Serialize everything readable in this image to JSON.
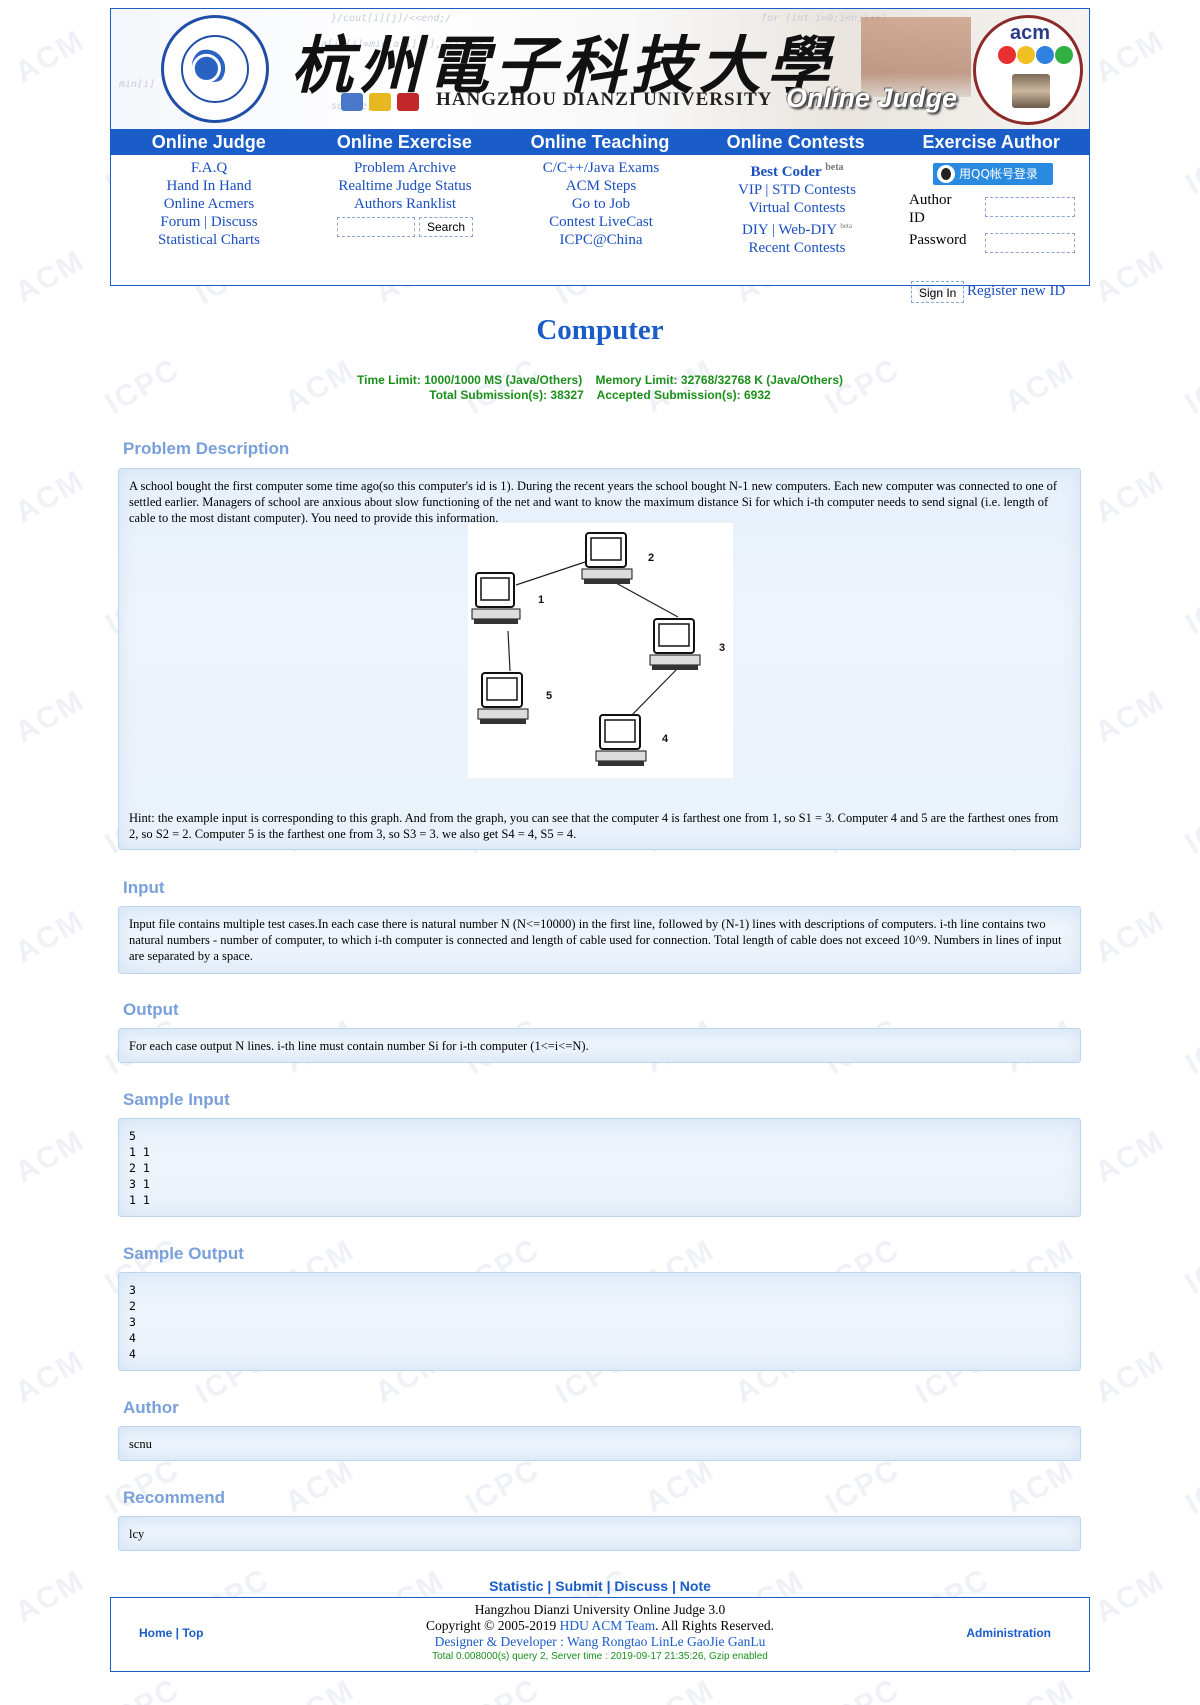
{
  "header": {
    "university_cn": "杭州電子科技大學",
    "university_en": "HANGZHOU DIANZI UNIVERSITY",
    "banner_label": "Online Judge",
    "acm_logo_text": "acm",
    "nav": [
      {
        "title": "Online Judge",
        "links": [
          "F.A.Q",
          "Hand In Hand",
          "Online Acmers",
          "Forum | Discuss",
          "Statistical Charts"
        ]
      },
      {
        "title": "Online Exercise",
        "links": [
          "Problem Archive",
          "Realtime Judge Status",
          "Authors Ranklist"
        ]
      },
      {
        "title": "Online Teaching",
        "links": [
          "C/C++/Java Exams",
          "ACM Steps",
          "Go to Job",
          "Contest LiveCast",
          "ICPC@China"
        ]
      },
      {
        "title": "Online Contests",
        "links": [
          "Best Coder",
          "VIP | STD Contests",
          "Virtual Contests",
          "DIY | Web-DIY",
          "Recent Contests"
        ]
      },
      {
        "title": "Exercise Author"
      }
    ],
    "search_button": "Search",
    "beta": "beta",
    "qq_login": "用QQ帐号登录",
    "author_id_label": "Author ID",
    "password_label": "Password",
    "signin": "Sign In",
    "register": "Register new ID"
  },
  "problem": {
    "title": "Computer",
    "limits_line1": "Time Limit: 1000/1000 MS (Java/Others)    Memory Limit: 32768/32768 K (Java/Others)",
    "limits_line2": "Total Submission(s): 38327    Accepted Submission(s): 6932",
    "description_heading": "Problem Description",
    "description": "A school bought the first computer some time ago(so this computer's id is 1). During the recent years the school bought N-1 new computers. Each new computer was connected to one of settled earlier. Managers of school are anxious about slow functioning of the net and want to know the maximum distance Si for which i-th computer needs to send signal (i.e. length of cable to the most distant computer). You need to provide this information.",
    "hint": "Hint: the example input is corresponding to this graph. And from the graph, you can see that the computer 4 is farthest one from 1, so S1 = 3. Computer 4 and 5 are the farthest ones from 2, so S2 = 2. Computer 5 is the farthest one from 3, so S3 = 3. we also get S4 = 4, S5 = 4.",
    "graph_labels": [
      "1",
      "2",
      "3",
      "4",
      "5"
    ],
    "input_heading": "Input",
    "input": "Input file contains multiple test cases.In each case there is natural number N (N<=10000) in the first line, followed by (N-1) lines with descriptions of computers. i-th line contains two natural numbers - number of computer, to which i-th computer is connected and length of cable used for connection. Total length of cable does not exceed 10^9. Numbers in lines of input are separated by a space.",
    "output_heading": "Output",
    "output": "For each case output N lines. i-th line must contain number Si for i-th computer (1<=i<=N).",
    "sample_input_heading": "Sample Input",
    "sample_input": "5\n1 1\n2 1\n3 1\n1 1",
    "sample_output_heading": "Sample Output",
    "sample_output": "3\n2\n3\n4\n4",
    "author_heading": "Author",
    "author": "scnu",
    "recommend_heading": "Recommend",
    "recommend": "lcy"
  },
  "footer": {
    "links": [
      "Statistic",
      "Submit",
      "Discuss",
      "Note"
    ],
    "home_top": "Home | Top",
    "administration": "Administration",
    "line1": "Hangzhou Dianzi University Online Judge 3.0",
    "copyright_prefix": "Copyright © 2005-2019 ",
    "team": "HDU ACM Team",
    "copyright_suffix": ". All Rights Reserved.",
    "designer": "Designer & Developer : Wang Rongtao LinLe GaoJie GanLu",
    "stats": "Total 0.008000(s) query 2, Server time : 2019-09-17 21:35:26, Gzip enabled"
  },
  "watermarks": [
    "ACM",
    "ICPC"
  ]
}
